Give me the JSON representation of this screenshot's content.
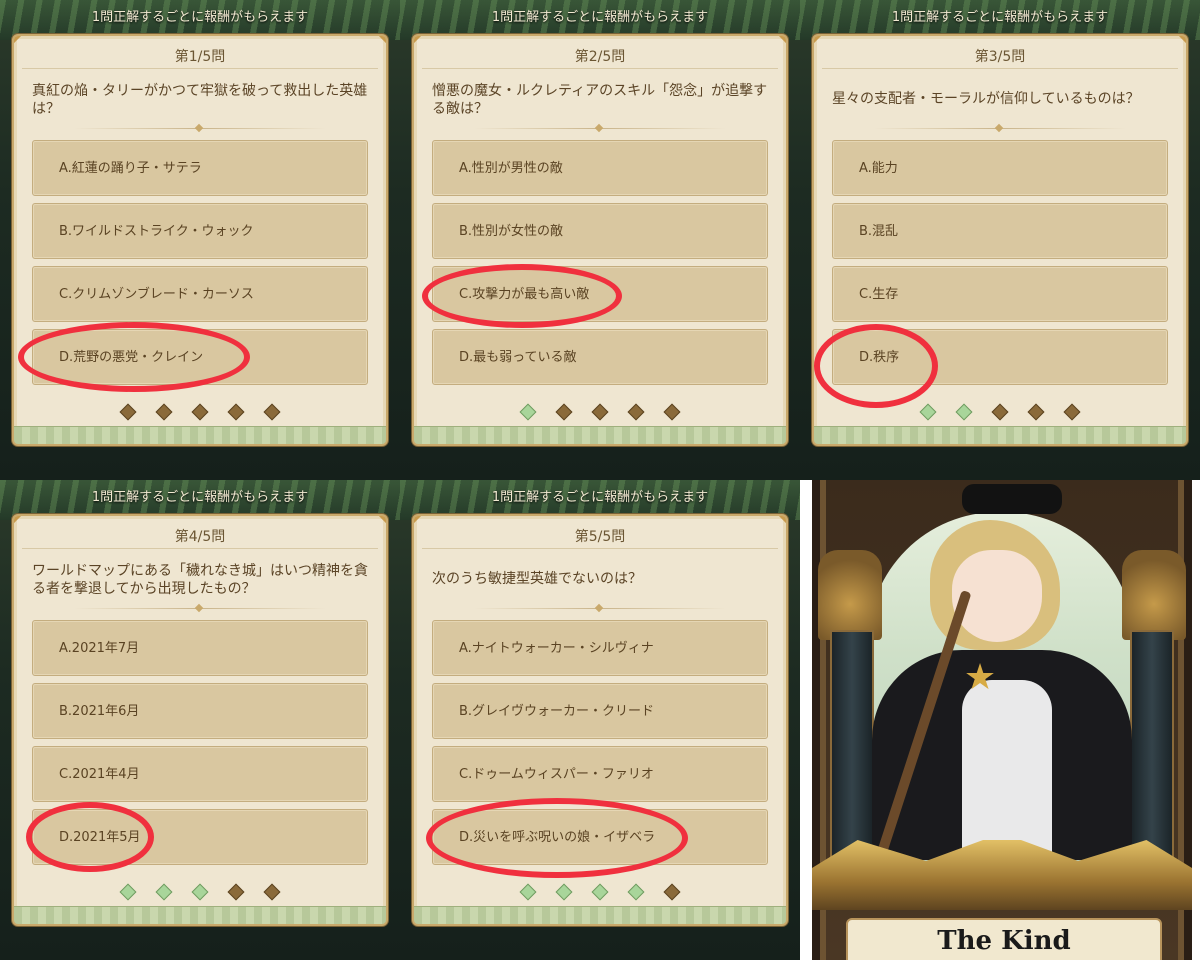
{
  "banner_text": "1問正解するごとに報酬がもらえます",
  "panels": [
    {
      "number": "第1/5問",
      "question": "真紅の焔・タリーがかつて牢獄を破って救出した英雄は？",
      "options": [
        "A.紅蓮の踊り子・サテラ",
        "B.ワイルドストライク・ウォック",
        "C.クリムゾンブレード・カーソス",
        "D.荒野の悪党・クレイン"
      ],
      "circled_option": "D",
      "progress_done": 0
    },
    {
      "number": "第2/5問",
      "question": "憎悪の魔女・ルクレティアのスキル「怨念」が追撃する敵は？",
      "options": [
        "A.性別が男性の敵",
        "B.性別が女性の敵",
        "C.攻撃力が最も高い敵",
        "D.最も弱っている敵"
      ],
      "circled_option": "C",
      "progress_done": 1
    },
    {
      "number": "第3/5問",
      "question": "星々の支配者・モーラルが信仰しているものは？",
      "options": [
        "A.能力",
        "B.混乱",
        "C.生存",
        "D.秩序"
      ],
      "circled_option": "D",
      "progress_done": 2
    },
    {
      "number": "第4/5問",
      "question": "ワールドマップにある「穢れなき城」はいつ精神を貪る者を撃退してから出現したもの？",
      "options": [
        "A.2021年7月",
        "B.2021年6月",
        "C.2021年4月",
        "D.2021年5月"
      ],
      "circled_option": "D",
      "progress_done": 3
    },
    {
      "number": "第5/5問",
      "question": "次のうち敏捷型英雄でないのは？",
      "options": [
        "A.ナイトウォーカー・シルヴィナ",
        "B.グレイヴウォーカー・クリード",
        "C.ドゥームウィスパー・ファリオ",
        "D.災いを呼ぶ呪いの娘・イザベラ"
      ],
      "circled_option": "D",
      "progress_done": 4
    }
  ],
  "hero_card": {
    "name": "The Kind"
  },
  "colors": {
    "highlight_circle": "#f0303e",
    "option_bg": "#d9c7a0",
    "card_bg": "#efe6d1"
  }
}
